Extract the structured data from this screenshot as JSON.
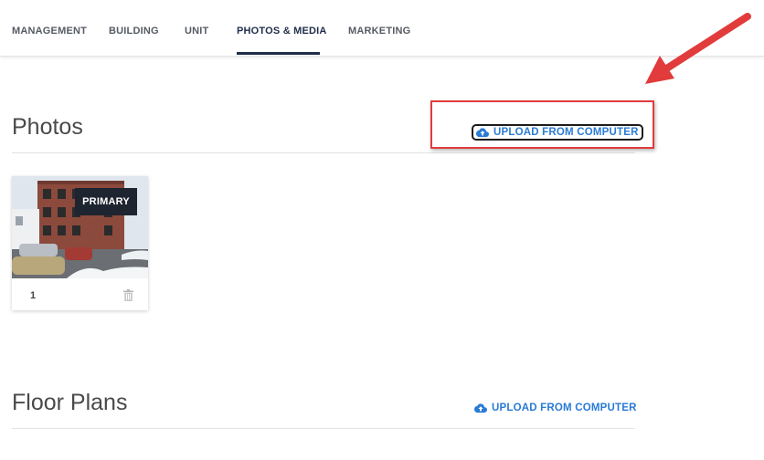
{
  "tabs": [
    {
      "label": "MANAGEMENT"
    },
    {
      "label": "BUILDING"
    },
    {
      "label": "UNIT"
    },
    {
      "label": "PHOTOS & MEDIA",
      "active": true
    },
    {
      "label": "MARKETING"
    }
  ],
  "photos_section": {
    "title": "Photos",
    "upload_label": "UPLOAD FROM COMPUTER",
    "items": [
      {
        "badge": "PRIMARY",
        "number": "1"
      }
    ]
  },
  "floor_plans_section": {
    "title": "Floor Plans",
    "upload_label": "UPLOAD FROM COMPUTER"
  },
  "colors": {
    "accent_blue": "#2a7bd4",
    "active_tab": "#1f2d4a",
    "annotation_red": "#e23b3b"
  },
  "icons": {
    "upload": "cloud-upload-icon",
    "delete": "trash-icon",
    "annotation": "red-arrow"
  }
}
